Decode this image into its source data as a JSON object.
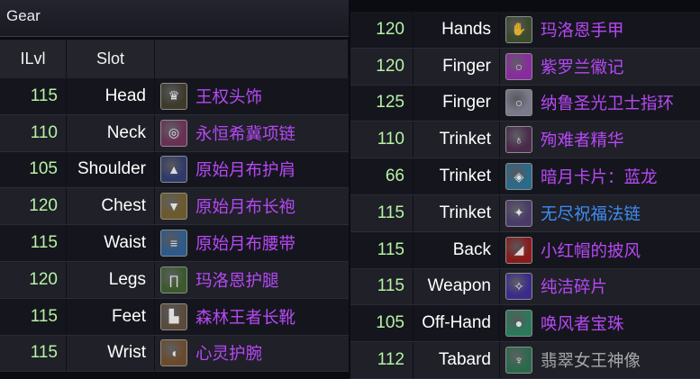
{
  "title": "Gear",
  "columns": {
    "ilvl": "ILvl",
    "slot": "Slot"
  },
  "quality_colors": {
    "epic": "#b748f5",
    "rare": "#3e8df2",
    "common": "#a8a8a8"
  },
  "left_rows": [
    {
      "ilvl": "115",
      "slot": "Head",
      "item": "王权头饰",
      "icon": "crown-helm-icon",
      "quality": "epic",
      "icon_bg": "#3d3a2a",
      "glyph": "♛"
    },
    {
      "ilvl": "110",
      "slot": "Neck",
      "item": "永恒希冀项链",
      "icon": "amulet-icon",
      "quality": "epic",
      "icon_bg": "#6a2f55",
      "glyph": "◎"
    },
    {
      "ilvl": "105",
      "slot": "Shoulder",
      "item": "原始月布护肩",
      "icon": "shoulder-icon",
      "quality": "epic",
      "icon_bg": "#2f3a6a",
      "glyph": "▲"
    },
    {
      "ilvl": "120",
      "slot": "Chest",
      "item": "原始月布长袍",
      "icon": "robe-icon",
      "quality": "epic",
      "icon_bg": "#6d5a2a",
      "glyph": "▼"
    },
    {
      "ilvl": "115",
      "slot": "Waist",
      "item": "原始月布腰带",
      "icon": "belt-icon",
      "quality": "epic",
      "icon_bg": "#2d5a8a",
      "glyph": "≡"
    },
    {
      "ilvl": "120",
      "slot": "Legs",
      "item": "玛洛恩护腿",
      "icon": "leggings-icon",
      "quality": "epic",
      "icon_bg": "#3a5a2a",
      "glyph": "∏"
    },
    {
      "ilvl": "115",
      "slot": "Feet",
      "item": "森林王者长靴",
      "icon": "boots-icon",
      "quality": "epic",
      "icon_bg": "#5a4a3a",
      "glyph": "▙"
    },
    {
      "ilvl": "115",
      "slot": "Wrist",
      "item": "心灵护腕",
      "icon": "bracer-icon",
      "quality": "epic",
      "icon_bg": "#6a4a2a",
      "glyph": "◖"
    }
  ],
  "right_rows": [
    {
      "ilvl": "120",
      "slot": "Hands",
      "item": "玛洛恩手甲",
      "icon": "gloves-icon",
      "quality": "epic",
      "icon_bg": "#3a4a2a",
      "glyph": "✋"
    },
    {
      "ilvl": "120",
      "slot": "Finger",
      "item": "紫罗兰徽记",
      "icon": "ring-icon",
      "quality": "epic",
      "icon_bg": "#8a2aa0",
      "glyph": "○"
    },
    {
      "ilvl": "125",
      "slot": "Finger",
      "item": "纳鲁圣光卫士指环",
      "icon": "ring-icon",
      "quality": "epic",
      "icon_bg": "#7a7a8a",
      "glyph": "○"
    },
    {
      "ilvl": "110",
      "slot": "Trinket",
      "item": "殉难者精华",
      "icon": "potion-icon",
      "quality": "epic",
      "icon_bg": "#4a2a4a",
      "glyph": "♁"
    },
    {
      "ilvl": "66",
      "slot": "Trinket",
      "item": "暗月卡片：蓝龙",
      "icon": "card-icon",
      "quality": "epic",
      "icon_bg": "#2a6a8a",
      "glyph": "◈"
    },
    {
      "ilvl": "115",
      "slot": "Trinket",
      "item": "无尽祝福法链",
      "icon": "chain-icon",
      "quality": "rare",
      "icon_bg": "#4a3a6a",
      "glyph": "✦"
    },
    {
      "ilvl": "115",
      "slot": "Back",
      "item": "小红帽的披风",
      "icon": "cloak-icon",
      "quality": "epic",
      "icon_bg": "#8a1a1a",
      "glyph": "◢"
    },
    {
      "ilvl": "115",
      "slot": "Weapon",
      "item": "纯洁碎片",
      "icon": "dagger-icon",
      "quality": "epic",
      "icon_bg": "#3a2a8a",
      "glyph": "✧"
    },
    {
      "ilvl": "105",
      "slot": "Off-Hand",
      "item": "唤风者宝珠",
      "icon": "orb-icon",
      "quality": "epic",
      "icon_bg": "#2a7a5a",
      "glyph": "●"
    },
    {
      "ilvl": "112",
      "slot": "Tabard",
      "item": "翡翠女王神像",
      "icon": "idol-icon",
      "quality": "common",
      "icon_bg": "#2a6a4a",
      "glyph": "♆"
    }
  ]
}
